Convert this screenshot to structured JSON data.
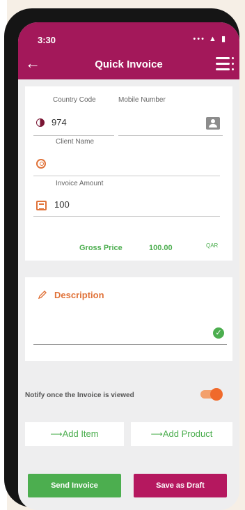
{
  "status": {
    "time": "3:30",
    "icons": "••• ▲ ▮"
  },
  "topbar": {
    "title": "Quick Invoice"
  },
  "form": {
    "country_code_label": "Country Code",
    "country_code_value": "974",
    "mobile_label": "Mobile Number",
    "mobile_value": "",
    "client_label": "Client Name",
    "client_value": "",
    "amount_label": "Invoice Amount",
    "amount_value": "100",
    "gross_label": "Gross Price",
    "gross_value": "100.00",
    "currency": "QAR"
  },
  "description": {
    "label": "Description",
    "value": ""
  },
  "notify": {
    "label": "Notify once the Invoice is viewed",
    "enabled": true
  },
  "actions": {
    "add_item": "Add Item",
    "add_product": "Add Product",
    "send": "Send Invoice",
    "draft": "Save as Draft"
  },
  "colors": {
    "brand": "#a3185a",
    "accent": "#e0733a",
    "success": "#4cae4f"
  },
  "icons": {
    "back": "arrow-left-icon",
    "menu": "menu-icon",
    "flag": "qatar-flag-icon",
    "contact": "contact-icon",
    "client": "client-icon",
    "amount": "invoice-icon",
    "description": "pencil-icon",
    "check": "check-icon",
    "toggle": "toggle-switch"
  }
}
